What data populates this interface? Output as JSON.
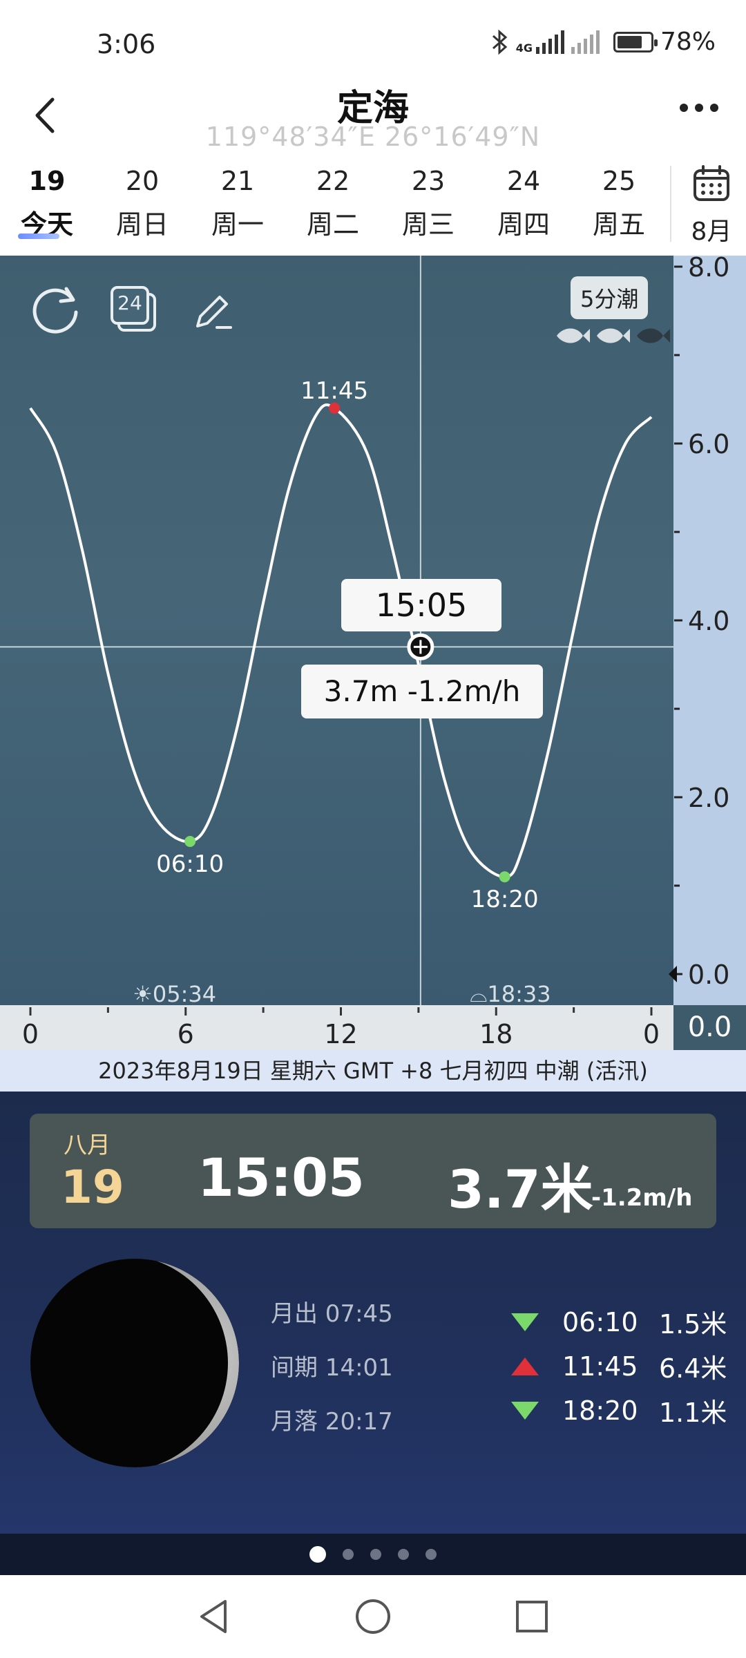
{
  "status_bar": {
    "time": "3:06",
    "battery": "78%",
    "battery_level": 0.78,
    "icons": [
      "bluetooth-icon",
      "signal-4g-icon",
      "signal-no-service-icon",
      "battery-icon"
    ]
  },
  "header": {
    "title": "定海",
    "coordinates": "119°48′34″E   26°16′49″N",
    "back_icon": "chevron-left-icon",
    "more_icon": "more-dots-icon"
  },
  "date_tabs": [
    {
      "day": "19",
      "label": "今天",
      "active": true
    },
    {
      "day": "20",
      "label": "周日"
    },
    {
      "day": "21",
      "label": "周一"
    },
    {
      "day": "22",
      "label": "周二"
    },
    {
      "day": "23",
      "label": "周三"
    },
    {
      "day": "24",
      "label": "周四"
    },
    {
      "day": "25",
      "label": "周五"
    }
  ],
  "calendar": {
    "month_label": "8月",
    "icon": "calendar-icon"
  },
  "chart_toolbar": {
    "refresh_icon": "refresh-icon",
    "day24_icon_label": "24",
    "edit_icon": "edit-icon",
    "interval_badge": "5分潮",
    "fish_rating": 2,
    "fish_max": 3
  },
  "chart_data": {
    "type": "line",
    "series": [
      {
        "x": [
          0,
          1,
          2,
          3,
          4,
          5,
          6.17,
          7,
          8,
          9,
          10,
          11,
          11.75,
          13,
          14,
          15,
          16,
          17,
          18.33,
          19,
          20,
          21,
          22,
          23,
          24
        ],
        "values": [
          6.4,
          5.9,
          4.8,
          3.4,
          2.3,
          1.7,
          1.5,
          1.8,
          2.8,
          4.2,
          5.5,
          6.3,
          6.4,
          5.9,
          4.8,
          3.5,
          2.2,
          1.4,
          1.1,
          1.4,
          2.5,
          3.9,
          5.2,
          6.0,
          6.3
        ]
      }
    ],
    "xlim": [
      0,
      24
    ],
    "ylim": [
      0,
      8
    ],
    "x_ticks": [
      "0",
      "6",
      "12",
      "18",
      "0"
    ],
    "y_ticks": [
      "8.0",
      "6.0",
      "4.0",
      "2.0",
      "0.0"
    ],
    "extremes": [
      {
        "time": "06:10",
        "x": 6.17,
        "y": 1.5,
        "kind": "low"
      },
      {
        "time": "11:45",
        "x": 11.75,
        "y": 6.4,
        "kind": "high"
      },
      {
        "time": "18:20",
        "x": 18.33,
        "y": 1.1,
        "kind": "low"
      }
    ],
    "cursor": {
      "x": 15.08,
      "y": 3.7,
      "time": "15:05",
      "value_label": "3.7m  -1.2m/h"
    },
    "sunrise": "05:34",
    "sunset": "18:33",
    "axis_right_footer": "0.0"
  },
  "info_line": "2023年8月19日  星期六  GMT +8  七月初四  中潮 (活汛)",
  "summary": {
    "month": "八月",
    "day": "19",
    "time": "15:05",
    "height": "3.7米",
    "rate": "-1.2m/h"
  },
  "moon": {
    "rise": "月出 07:45",
    "interval": "间期 14:01",
    "set": "月落 20:17"
  },
  "tide_list": [
    {
      "time": "06:10",
      "height": "1.5米",
      "kind": "low"
    },
    {
      "time": "11:45",
      "height": "6.4米",
      "kind": "high"
    },
    {
      "time": "18:20",
      "height": "1.1米",
      "kind": "low"
    }
  ],
  "pager": {
    "count": 5,
    "active": 0
  },
  "nav_bar": {
    "back": "nav-back-icon",
    "home": "nav-home-icon",
    "recents": "nav-recents-icon"
  },
  "colors": {
    "chart_bg": "#426375",
    "axis_strip": "#b9cde6",
    "low_marker": "#7ad96a",
    "high_marker": "#e0303a",
    "summary_accent": "#f4d596",
    "lower_panel": "#1f2f58"
  }
}
